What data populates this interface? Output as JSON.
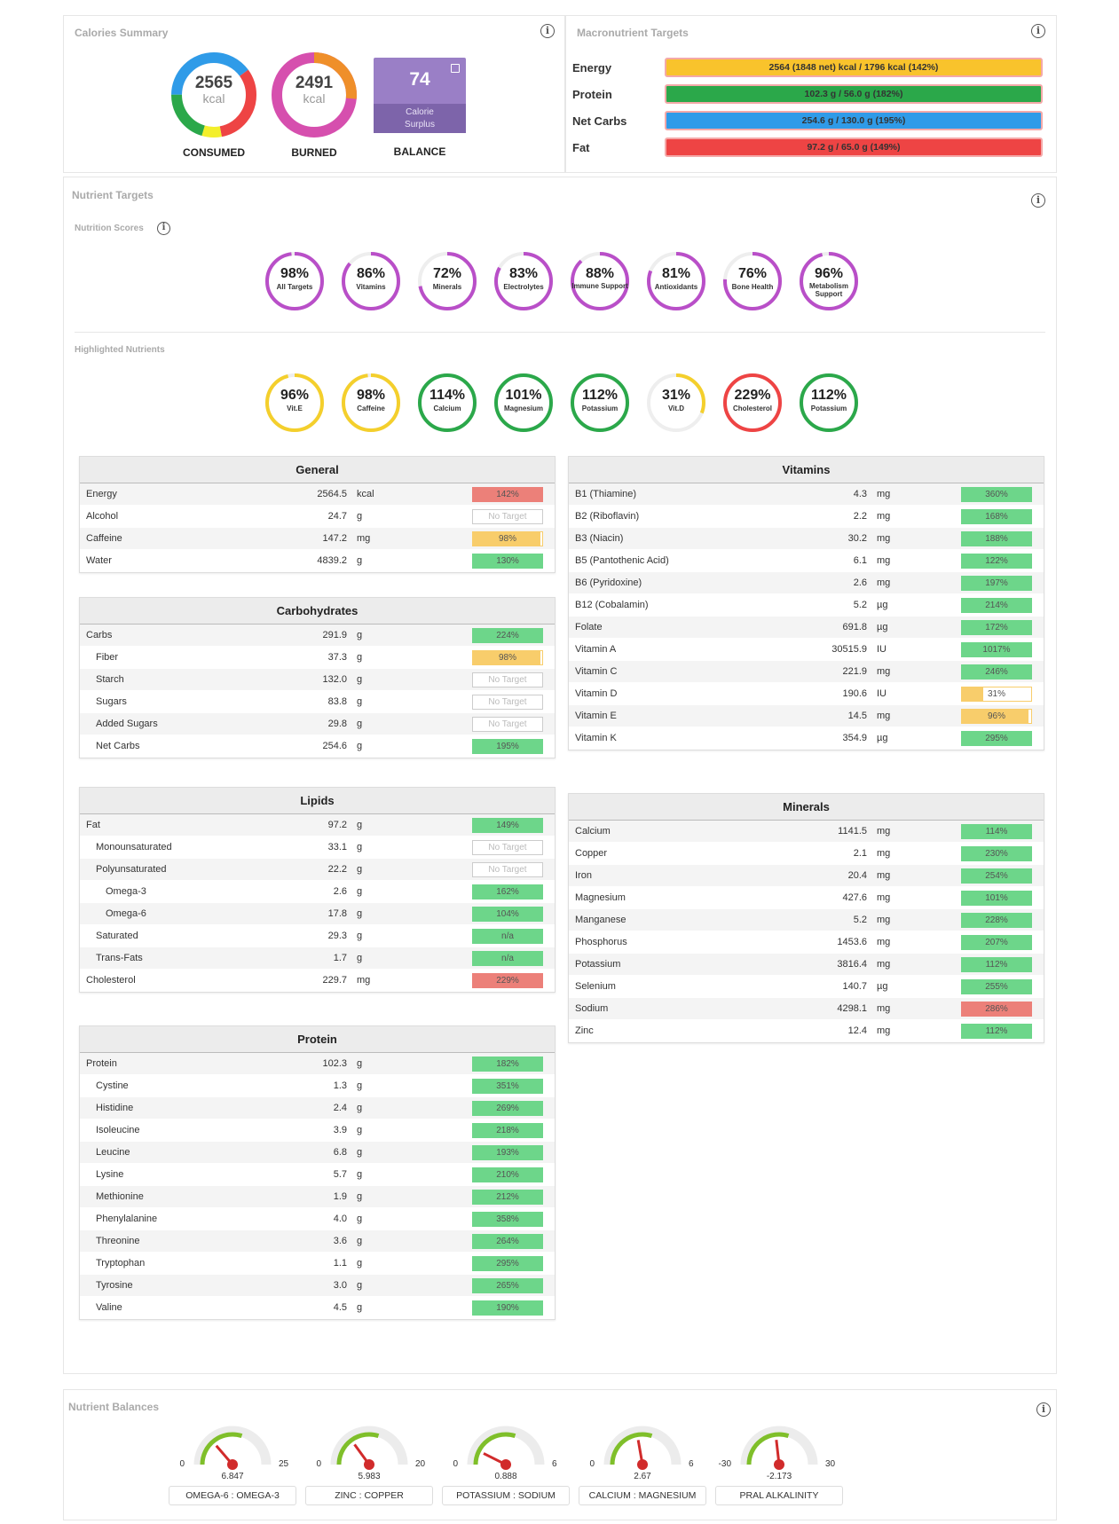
{
  "calories": {
    "title": "Calories Summary",
    "consumed": {
      "value": "2565",
      "unit": "kcal",
      "label": "CONSUMED"
    },
    "burned": {
      "value": "2491",
      "unit": "kcal",
      "label": "BURNED"
    },
    "balance": {
      "value": "74",
      "caption_line1": "Calorie",
      "caption_line2": "Surplus",
      "label": "BALANCE"
    }
  },
  "macros": {
    "title": "Macronutrient Targets",
    "rows": [
      {
        "name": "Energy",
        "text": "2564 (1848 net) kcal / 1796 kcal (142%)",
        "color": "#f9c32c"
      },
      {
        "name": "Protein",
        "text": "102.3 g / 56.0 g (182%)",
        "color": "#2ba84a"
      },
      {
        "name": "Net Carbs",
        "text": "254.6 g / 130.0 g (195%)",
        "color": "#2f9be8"
      },
      {
        "name": "Fat",
        "text": "97.2 g / 65.0 g (149%)",
        "color": "#ee4444"
      }
    ]
  },
  "nutrient_targets": {
    "title": "Nutrient Targets",
    "scores_title": "Nutrition Scores",
    "scores": [
      {
        "pct": "98%",
        "name": "All Targets",
        "frac": 0.98,
        "color": "#b94fc8"
      },
      {
        "pct": "86%",
        "name": "Vitamins",
        "frac": 0.86,
        "color": "#b94fc8"
      },
      {
        "pct": "72%",
        "name": "Minerals",
        "frac": 0.72,
        "color": "#b94fc8"
      },
      {
        "pct": "83%",
        "name": "Electrolytes",
        "frac": 0.83,
        "color": "#b94fc8"
      },
      {
        "pct": "88%",
        "name": "Immune Support",
        "frac": 0.88,
        "color": "#b94fc8"
      },
      {
        "pct": "81%",
        "name": "Antioxidants",
        "frac": 0.81,
        "color": "#b94fc8"
      },
      {
        "pct": "76%",
        "name": "Bone Health",
        "frac": 0.76,
        "color": "#b94fc8"
      },
      {
        "pct": "96%",
        "name": "Metabolism Support",
        "frac": 0.96,
        "color": "#b94fc8"
      }
    ],
    "highlight_title": "Highlighted Nutrients",
    "highlights": [
      {
        "pct": "96%",
        "name": "Vit.E",
        "frac": 0.96,
        "color": "#f4cf2c"
      },
      {
        "pct": "98%",
        "name": "Caffeine",
        "frac": 0.98,
        "color": "#f4cf2c"
      },
      {
        "pct": "114%",
        "name": "Calcium",
        "frac": 1,
        "color": "#2ba84a"
      },
      {
        "pct": "101%",
        "name": "Magnesium",
        "frac": 1,
        "color": "#2ba84a"
      },
      {
        "pct": "112%",
        "name": "Potassium",
        "frac": 1,
        "color": "#2ba84a"
      },
      {
        "pct": "31%",
        "name": "Vit.D",
        "frac": 0.31,
        "color": "#f4cf2c"
      },
      {
        "pct": "229%",
        "name": "Cholesterol",
        "frac": 1,
        "color": "#ee4444"
      },
      {
        "pct": "112%",
        "name": "Potassium",
        "frac": 1,
        "color": "#2ba84a"
      }
    ]
  },
  "tables": {
    "general": {
      "title": "General",
      "rows": [
        {
          "name": "Energy",
          "value": "2564.5",
          "unit": "kcal",
          "bar": "142%",
          "color": "#ec8079",
          "frac": 1
        },
        {
          "name": "Alcohol",
          "value": "24.7",
          "unit": "g",
          "bar": "No Target",
          "color": "",
          "frac": 0
        },
        {
          "name": "Caffeine",
          "value": "147.2",
          "unit": "mg",
          "bar": "98%",
          "color": "#f8cd6b",
          "frac": 0.98
        },
        {
          "name": "Water",
          "value": "4839.2",
          "unit": "g",
          "bar": "130%",
          "color": "#6dd68a",
          "frac": 1
        }
      ]
    },
    "carbs": {
      "title": "Carbohydrates",
      "rows": [
        {
          "name": "Carbs",
          "value": "291.9",
          "unit": "g",
          "bar": "224%",
          "color": "#6dd68a",
          "frac": 1,
          "indent": 0
        },
        {
          "name": "Fiber",
          "value": "37.3",
          "unit": "g",
          "bar": "98%",
          "color": "#f8cd6b",
          "frac": 0.98,
          "indent": 1
        },
        {
          "name": "Starch",
          "value": "132.0",
          "unit": "g",
          "bar": "No Target",
          "color": "",
          "frac": 0,
          "indent": 1
        },
        {
          "name": "Sugars",
          "value": "83.8",
          "unit": "g",
          "bar": "No Target",
          "color": "",
          "frac": 0,
          "indent": 1
        },
        {
          "name": "Added Sugars",
          "value": "29.8",
          "unit": "g",
          "bar": "No Target",
          "color": "",
          "frac": 0,
          "indent": 1
        },
        {
          "name": "Net Carbs",
          "value": "254.6",
          "unit": "g",
          "bar": "195%",
          "color": "#6dd68a",
          "frac": 1,
          "indent": 1
        }
      ]
    },
    "lipids": {
      "title": "Lipids",
      "rows": [
        {
          "name": "Fat",
          "value": "97.2",
          "unit": "g",
          "bar": "149%",
          "color": "#6dd68a",
          "frac": 1,
          "indent": 0
        },
        {
          "name": "Monounsaturated",
          "value": "33.1",
          "unit": "g",
          "bar": "No Target",
          "color": "",
          "frac": 0,
          "indent": 1
        },
        {
          "name": "Polyunsaturated",
          "value": "22.2",
          "unit": "g",
          "bar": "No Target",
          "color": "",
          "frac": 0,
          "indent": 1
        },
        {
          "name": "Omega-3",
          "value": "2.6",
          "unit": "g",
          "bar": "162%",
          "color": "#6dd68a",
          "frac": 1,
          "indent": 2
        },
        {
          "name": "Omega-6",
          "value": "17.8",
          "unit": "g",
          "bar": "104%",
          "color": "#6dd68a",
          "frac": 1,
          "indent": 2
        },
        {
          "name": "Saturated",
          "value": "29.3",
          "unit": "g",
          "bar": "n/a",
          "color": "#6dd68a",
          "frac": 1,
          "indent": 1
        },
        {
          "name": "Trans-Fats",
          "value": "1.7",
          "unit": "g",
          "bar": "n/a",
          "color": "#6dd68a",
          "frac": 1,
          "indent": 1
        },
        {
          "name": "Cholesterol",
          "value": "229.7",
          "unit": "mg",
          "bar": "229%",
          "color": "#ec8079",
          "frac": 1,
          "indent": 0
        }
      ]
    },
    "protein": {
      "title": "Protein",
      "rows": [
        {
          "name": "Protein",
          "value": "102.3",
          "unit": "g",
          "bar": "182%",
          "color": "#6dd68a",
          "frac": 1,
          "indent": 0
        },
        {
          "name": "Cystine",
          "value": "1.3",
          "unit": "g",
          "bar": "351%",
          "color": "#6dd68a",
          "frac": 1,
          "indent": 1
        },
        {
          "name": "Histidine",
          "value": "2.4",
          "unit": "g",
          "bar": "269%",
          "color": "#6dd68a",
          "frac": 1,
          "indent": 1
        },
        {
          "name": "Isoleucine",
          "value": "3.9",
          "unit": "g",
          "bar": "218%",
          "color": "#6dd68a",
          "frac": 1,
          "indent": 1
        },
        {
          "name": "Leucine",
          "value": "6.8",
          "unit": "g",
          "bar": "193%",
          "color": "#6dd68a",
          "frac": 1,
          "indent": 1
        },
        {
          "name": "Lysine",
          "value": "5.7",
          "unit": "g",
          "bar": "210%",
          "color": "#6dd68a",
          "frac": 1,
          "indent": 1
        },
        {
          "name": "Methionine",
          "value": "1.9",
          "unit": "g",
          "bar": "212%",
          "color": "#6dd68a",
          "frac": 1,
          "indent": 1
        },
        {
          "name": "Phenylalanine",
          "value": "4.0",
          "unit": "g",
          "bar": "358%",
          "color": "#6dd68a",
          "frac": 1,
          "indent": 1
        },
        {
          "name": "Threonine",
          "value": "3.6",
          "unit": "g",
          "bar": "264%",
          "color": "#6dd68a",
          "frac": 1,
          "indent": 1
        },
        {
          "name": "Tryptophan",
          "value": "1.1",
          "unit": "g",
          "bar": "295%",
          "color": "#6dd68a",
          "frac": 1,
          "indent": 1
        },
        {
          "name": "Tyrosine",
          "value": "3.0",
          "unit": "g",
          "bar": "265%",
          "color": "#6dd68a",
          "frac": 1,
          "indent": 1
        },
        {
          "name": "Valine",
          "value": "4.5",
          "unit": "g",
          "bar": "190%",
          "color": "#6dd68a",
          "frac": 1,
          "indent": 1
        }
      ]
    },
    "vitamins": {
      "title": "Vitamins",
      "rows": [
        {
          "name": "B1 (Thiamine)",
          "value": "4.3",
          "unit": "mg",
          "bar": "360%",
          "color": "#6dd68a",
          "frac": 1
        },
        {
          "name": "B2 (Riboflavin)",
          "value": "2.2",
          "unit": "mg",
          "bar": "168%",
          "color": "#6dd68a",
          "frac": 1
        },
        {
          "name": "B3 (Niacin)",
          "value": "30.2",
          "unit": "mg",
          "bar": "188%",
          "color": "#6dd68a",
          "frac": 1
        },
        {
          "name": "B5 (Pantothenic Acid)",
          "value": "6.1",
          "unit": "mg",
          "bar": "122%",
          "color": "#6dd68a",
          "frac": 1
        },
        {
          "name": "B6 (Pyridoxine)",
          "value": "2.6",
          "unit": "mg",
          "bar": "197%",
          "color": "#6dd68a",
          "frac": 1
        },
        {
          "name": "B12 (Cobalamin)",
          "value": "5.2",
          "unit": "µg",
          "bar": "214%",
          "color": "#6dd68a",
          "frac": 1
        },
        {
          "name": "Folate",
          "value": "691.8",
          "unit": "µg",
          "bar": "172%",
          "color": "#6dd68a",
          "frac": 1
        },
        {
          "name": "Vitamin A",
          "value": "30515.9",
          "unit": "IU",
          "bar": "1017%",
          "color": "#6dd68a",
          "frac": 1
        },
        {
          "name": "Vitamin C",
          "value": "221.9",
          "unit": "mg",
          "bar": "246%",
          "color": "#6dd68a",
          "frac": 1
        },
        {
          "name": "Vitamin D",
          "value": "190.6",
          "unit": "IU",
          "bar": "31%",
          "color": "#f8cd6b",
          "frac": 0.31
        },
        {
          "name": "Vitamin E",
          "value": "14.5",
          "unit": "mg",
          "bar": "96%",
          "color": "#f8cd6b",
          "frac": 0.96
        },
        {
          "name": "Vitamin K",
          "value": "354.9",
          "unit": "µg",
          "bar": "295%",
          "color": "#6dd68a",
          "frac": 1
        }
      ]
    },
    "minerals": {
      "title": "Minerals",
      "rows": [
        {
          "name": "Calcium",
          "value": "1141.5",
          "unit": "mg",
          "bar": "114%",
          "color": "#6dd68a",
          "frac": 1
        },
        {
          "name": "Copper",
          "value": "2.1",
          "unit": "mg",
          "bar": "230%",
          "color": "#6dd68a",
          "frac": 1
        },
        {
          "name": "Iron",
          "value": "20.4",
          "unit": "mg",
          "bar": "254%",
          "color": "#6dd68a",
          "frac": 1
        },
        {
          "name": "Magnesium",
          "value": "427.6",
          "unit": "mg",
          "bar": "101%",
          "color": "#6dd68a",
          "frac": 1
        },
        {
          "name": "Manganese",
          "value": "5.2",
          "unit": "mg",
          "bar": "228%",
          "color": "#6dd68a",
          "frac": 1
        },
        {
          "name": "Phosphorus",
          "value": "1453.6",
          "unit": "mg",
          "bar": "207%",
          "color": "#6dd68a",
          "frac": 1
        },
        {
          "name": "Potassium",
          "value": "3816.4",
          "unit": "mg",
          "bar": "112%",
          "color": "#6dd68a",
          "frac": 1
        },
        {
          "name": "Selenium",
          "value": "140.7",
          "unit": "µg",
          "bar": "255%",
          "color": "#6dd68a",
          "frac": 1
        },
        {
          "name": "Sodium",
          "value": "4298.1",
          "unit": "mg",
          "bar": "286%",
          "color": "#ec8079",
          "frac": 1
        },
        {
          "name": "Zinc",
          "value": "12.4",
          "unit": "mg",
          "bar": "112%",
          "color": "#6dd68a",
          "frac": 1
        }
      ]
    }
  },
  "balances": {
    "title": "Nutrient Balances",
    "gauges": [
      {
        "label": "OMEGA-6 : OMEGA-3",
        "min": "0",
        "max": "25",
        "value": "6.847",
        "frac": 0.274
      },
      {
        "label": "ZINC : COPPER",
        "min": "0",
        "max": "20",
        "value": "5.983",
        "frac": 0.3
      },
      {
        "label": "POTASSIUM : SODIUM",
        "min": "0",
        "max": "6",
        "value": "0.888",
        "frac": 0.148
      },
      {
        "label": "CALCIUM : MAGNESIUM",
        "min": "0",
        "max": "6",
        "value": "2.67",
        "frac": 0.445
      },
      {
        "label": "PRAL ALKALINITY",
        "min": "-30",
        "max": "30",
        "value": "-2.173",
        "frac": 0.464
      }
    ]
  }
}
